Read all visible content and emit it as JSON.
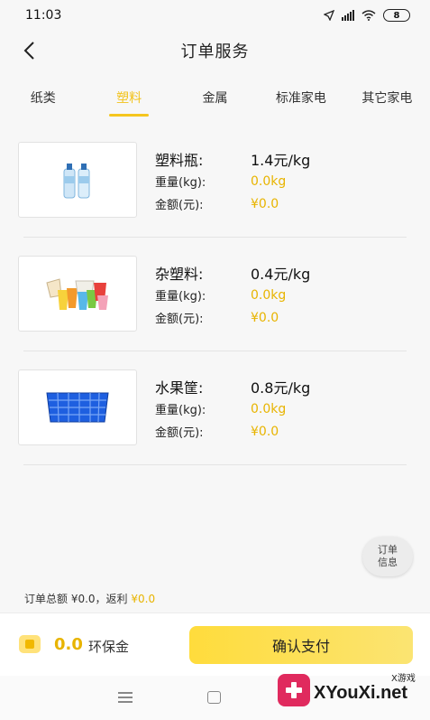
{
  "status_bar": {
    "time": "11:03",
    "battery": "8"
  },
  "header": {
    "title": "订单服务"
  },
  "tabs": [
    {
      "label": "纸类"
    },
    {
      "label": "塑料"
    },
    {
      "label": "金属"
    },
    {
      "label": "标准家电"
    },
    {
      "label": "其它家电"
    }
  ],
  "active_tab": "塑料",
  "products": [
    {
      "name": "塑料瓶:",
      "price": "1.4元/kg",
      "weight_label": "重量(kg):",
      "weight": "0.0kg",
      "amount_label": "金额(元):",
      "amount": "¥0.0",
      "image": "plastic-bottles"
    },
    {
      "name": "杂塑料:",
      "price": "0.4元/kg",
      "weight_label": "重量(kg):",
      "weight": "0.0kg",
      "amount_label": "金额(元):",
      "amount": "¥0.0",
      "image": "mixed-plastic-cups"
    },
    {
      "name": "水果筐:",
      "price": "0.8元/kg",
      "weight_label": "重量(kg):",
      "weight": "0.0kg",
      "amount_label": "金额(元):",
      "amount": "¥0.0",
      "image": "blue-fruit-crate"
    }
  ],
  "order_info_button": {
    "line1": "订单",
    "line2": "信息"
  },
  "summary": {
    "total_text": "订单总额 ¥0.0，返利 ",
    "rebate": "¥0.0"
  },
  "bottom_bar": {
    "deposit_amount": "0.0",
    "deposit_label": "环保金",
    "pay_label": "确认支付"
  },
  "watermark": {
    "site": "XYouXi.net",
    "sub": "X游戏"
  },
  "colors": {
    "accent": "#f5c61e",
    "price_text": "#e8b400",
    "background": "#f7f7f7"
  }
}
